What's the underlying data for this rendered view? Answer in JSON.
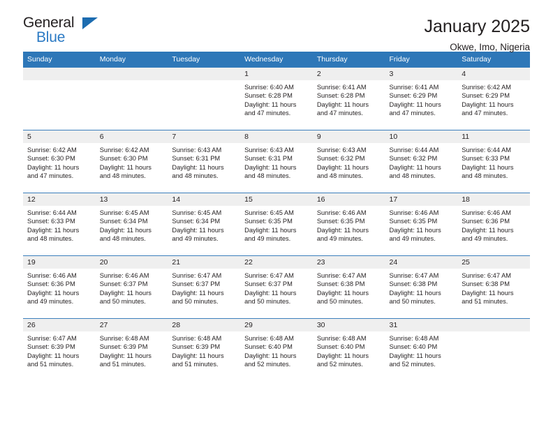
{
  "brand": {
    "name_part1": "General",
    "name_part2": "Blue",
    "accent_color": "#2b7ac4",
    "triangle_color": "#1c6cb0",
    "logo_icon": "triangle-flag-icon"
  },
  "header": {
    "title": "January 2025",
    "location": "Okwe, Imo, Nigeria"
  },
  "theme": {
    "header_row_bg": "#2e77b8",
    "header_row_text": "#ffffff",
    "daynum_band_bg": "#efefef",
    "cell_text": "#231f20",
    "grid_line": "#2e77b8"
  },
  "weekday_headers": [
    "Sunday",
    "Monday",
    "Tuesday",
    "Wednesday",
    "Thursday",
    "Friday",
    "Saturday"
  ],
  "labels": {
    "sunrise_prefix": "Sunrise:",
    "sunset_prefix": "Sunset:",
    "daylight_prefix": "Daylight:"
  },
  "weeks": [
    [
      {
        "day": "",
        "empty": true,
        "line1": "",
        "line2": "",
        "line3": "",
        "line4": ""
      },
      {
        "day": "",
        "empty": true,
        "line1": "",
        "line2": "",
        "line3": "",
        "line4": ""
      },
      {
        "day": "",
        "empty": true,
        "line1": "",
        "line2": "",
        "line3": "",
        "line4": ""
      },
      {
        "day": "1",
        "empty": false,
        "line1": "Sunrise: 6:40 AM",
        "line2": "Sunset: 6:28 PM",
        "line3": "Daylight: 11 hours",
        "line4": "and 47 minutes."
      },
      {
        "day": "2",
        "empty": false,
        "line1": "Sunrise: 6:41 AM",
        "line2": "Sunset: 6:28 PM",
        "line3": "Daylight: 11 hours",
        "line4": "and 47 minutes."
      },
      {
        "day": "3",
        "empty": false,
        "line1": "Sunrise: 6:41 AM",
        "line2": "Sunset: 6:29 PM",
        "line3": "Daylight: 11 hours",
        "line4": "and 47 minutes."
      },
      {
        "day": "4",
        "empty": false,
        "line1": "Sunrise: 6:42 AM",
        "line2": "Sunset: 6:29 PM",
        "line3": "Daylight: 11 hours",
        "line4": "and 47 minutes."
      }
    ],
    [
      {
        "day": "5",
        "empty": false,
        "line1": "Sunrise: 6:42 AM",
        "line2": "Sunset: 6:30 PM",
        "line3": "Daylight: 11 hours",
        "line4": "and 47 minutes."
      },
      {
        "day": "6",
        "empty": false,
        "line1": "Sunrise: 6:42 AM",
        "line2": "Sunset: 6:30 PM",
        "line3": "Daylight: 11 hours",
        "line4": "and 48 minutes."
      },
      {
        "day": "7",
        "empty": false,
        "line1": "Sunrise: 6:43 AM",
        "line2": "Sunset: 6:31 PM",
        "line3": "Daylight: 11 hours",
        "line4": "and 48 minutes."
      },
      {
        "day": "8",
        "empty": false,
        "line1": "Sunrise: 6:43 AM",
        "line2": "Sunset: 6:31 PM",
        "line3": "Daylight: 11 hours",
        "line4": "and 48 minutes."
      },
      {
        "day": "9",
        "empty": false,
        "line1": "Sunrise: 6:43 AM",
        "line2": "Sunset: 6:32 PM",
        "line3": "Daylight: 11 hours",
        "line4": "and 48 minutes."
      },
      {
        "day": "10",
        "empty": false,
        "line1": "Sunrise: 6:44 AM",
        "line2": "Sunset: 6:32 PM",
        "line3": "Daylight: 11 hours",
        "line4": "and 48 minutes."
      },
      {
        "day": "11",
        "empty": false,
        "line1": "Sunrise: 6:44 AM",
        "line2": "Sunset: 6:33 PM",
        "line3": "Daylight: 11 hours",
        "line4": "and 48 minutes."
      }
    ],
    [
      {
        "day": "12",
        "empty": false,
        "line1": "Sunrise: 6:44 AM",
        "line2": "Sunset: 6:33 PM",
        "line3": "Daylight: 11 hours",
        "line4": "and 48 minutes."
      },
      {
        "day": "13",
        "empty": false,
        "line1": "Sunrise: 6:45 AM",
        "line2": "Sunset: 6:34 PM",
        "line3": "Daylight: 11 hours",
        "line4": "and 48 minutes."
      },
      {
        "day": "14",
        "empty": false,
        "line1": "Sunrise: 6:45 AM",
        "line2": "Sunset: 6:34 PM",
        "line3": "Daylight: 11 hours",
        "line4": "and 49 minutes."
      },
      {
        "day": "15",
        "empty": false,
        "line1": "Sunrise: 6:45 AM",
        "line2": "Sunset: 6:35 PM",
        "line3": "Daylight: 11 hours",
        "line4": "and 49 minutes."
      },
      {
        "day": "16",
        "empty": false,
        "line1": "Sunrise: 6:46 AM",
        "line2": "Sunset: 6:35 PM",
        "line3": "Daylight: 11 hours",
        "line4": "and 49 minutes."
      },
      {
        "day": "17",
        "empty": false,
        "line1": "Sunrise: 6:46 AM",
        "line2": "Sunset: 6:35 PM",
        "line3": "Daylight: 11 hours",
        "line4": "and 49 minutes."
      },
      {
        "day": "18",
        "empty": false,
        "line1": "Sunrise: 6:46 AM",
        "line2": "Sunset: 6:36 PM",
        "line3": "Daylight: 11 hours",
        "line4": "and 49 minutes."
      }
    ],
    [
      {
        "day": "19",
        "empty": false,
        "line1": "Sunrise: 6:46 AM",
        "line2": "Sunset: 6:36 PM",
        "line3": "Daylight: 11 hours",
        "line4": "and 49 minutes."
      },
      {
        "day": "20",
        "empty": false,
        "line1": "Sunrise: 6:46 AM",
        "line2": "Sunset: 6:37 PM",
        "line3": "Daylight: 11 hours",
        "line4": "and 50 minutes."
      },
      {
        "day": "21",
        "empty": false,
        "line1": "Sunrise: 6:47 AM",
        "line2": "Sunset: 6:37 PM",
        "line3": "Daylight: 11 hours",
        "line4": "and 50 minutes."
      },
      {
        "day": "22",
        "empty": false,
        "line1": "Sunrise: 6:47 AM",
        "line2": "Sunset: 6:37 PM",
        "line3": "Daylight: 11 hours",
        "line4": "and 50 minutes."
      },
      {
        "day": "23",
        "empty": false,
        "line1": "Sunrise: 6:47 AM",
        "line2": "Sunset: 6:38 PM",
        "line3": "Daylight: 11 hours",
        "line4": "and 50 minutes."
      },
      {
        "day": "24",
        "empty": false,
        "line1": "Sunrise: 6:47 AM",
        "line2": "Sunset: 6:38 PM",
        "line3": "Daylight: 11 hours",
        "line4": "and 50 minutes."
      },
      {
        "day": "25",
        "empty": false,
        "line1": "Sunrise: 6:47 AM",
        "line2": "Sunset: 6:38 PM",
        "line3": "Daylight: 11 hours",
        "line4": "and 51 minutes."
      }
    ],
    [
      {
        "day": "26",
        "empty": false,
        "line1": "Sunrise: 6:47 AM",
        "line2": "Sunset: 6:39 PM",
        "line3": "Daylight: 11 hours",
        "line4": "and 51 minutes."
      },
      {
        "day": "27",
        "empty": false,
        "line1": "Sunrise: 6:48 AM",
        "line2": "Sunset: 6:39 PM",
        "line3": "Daylight: 11 hours",
        "line4": "and 51 minutes."
      },
      {
        "day": "28",
        "empty": false,
        "line1": "Sunrise: 6:48 AM",
        "line2": "Sunset: 6:39 PM",
        "line3": "Daylight: 11 hours",
        "line4": "and 51 minutes."
      },
      {
        "day": "29",
        "empty": false,
        "line1": "Sunrise: 6:48 AM",
        "line2": "Sunset: 6:40 PM",
        "line3": "Daylight: 11 hours",
        "line4": "and 52 minutes."
      },
      {
        "day": "30",
        "empty": false,
        "line1": "Sunrise: 6:48 AM",
        "line2": "Sunset: 6:40 PM",
        "line3": "Daylight: 11 hours",
        "line4": "and 52 minutes."
      },
      {
        "day": "31",
        "empty": false,
        "line1": "Sunrise: 6:48 AM",
        "line2": "Sunset: 6:40 PM",
        "line3": "Daylight: 11 hours",
        "line4": "and 52 minutes."
      },
      {
        "day": "",
        "empty": true,
        "line1": "",
        "line2": "",
        "line3": "",
        "line4": ""
      }
    ]
  ]
}
